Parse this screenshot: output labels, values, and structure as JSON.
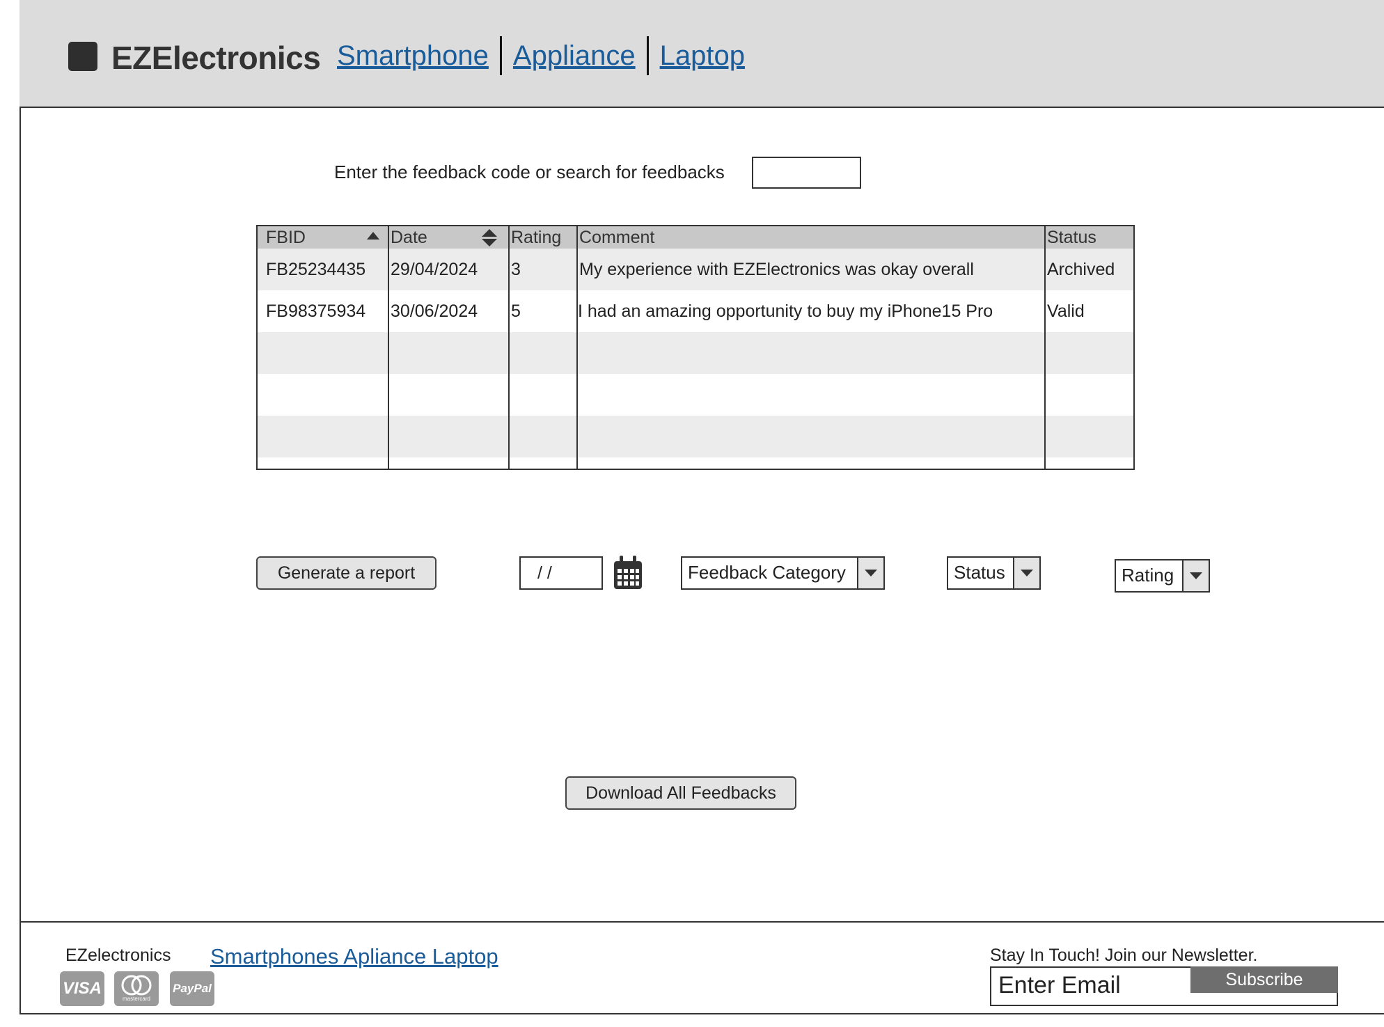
{
  "header": {
    "brand": "EZElectronics",
    "nav": [
      "Smartphone",
      "Appliance",
      "Laptop"
    ]
  },
  "search": {
    "label": "Enter the feedback code or search for feedbacks",
    "value": ""
  },
  "table": {
    "columns": [
      "FBID",
      "Date",
      "Rating",
      "Comment",
      "Status"
    ],
    "rows": [
      {
        "fbid": "FB25234435",
        "date": "29/04/2024",
        "rating": "3",
        "comment": "My experience with EZElectronics was okay overall",
        "status": "Archived"
      },
      {
        "fbid": "FB98375934",
        "date": "30/06/2024",
        "rating": "5",
        "comment": "I had an amazing opportunity to buy my iPhone15 Pro",
        "status": "Valid"
      }
    ]
  },
  "controls": {
    "generate_report": "Generate a report",
    "date_value": "/ /",
    "feedback_category": "Feedback Category",
    "status": "Status",
    "rating": "Rating",
    "download_all": "Download All Feedbacks"
  },
  "footer": {
    "brand": "EZelectronics",
    "links": "Smartphones Apliance Laptop",
    "payments": [
      "VISA",
      "mastercard",
      "PayPal"
    ],
    "newsletter_label": "Stay In Touch! Join our Newsletter.",
    "email_placeholder": "Enter Email",
    "subscribe": "Subscribe"
  },
  "colors": {
    "header_bg": "#dcdcdc",
    "link": "#1a5b9a",
    "row_alt": "#ececec",
    "table_header": "#c8c8c8"
  }
}
